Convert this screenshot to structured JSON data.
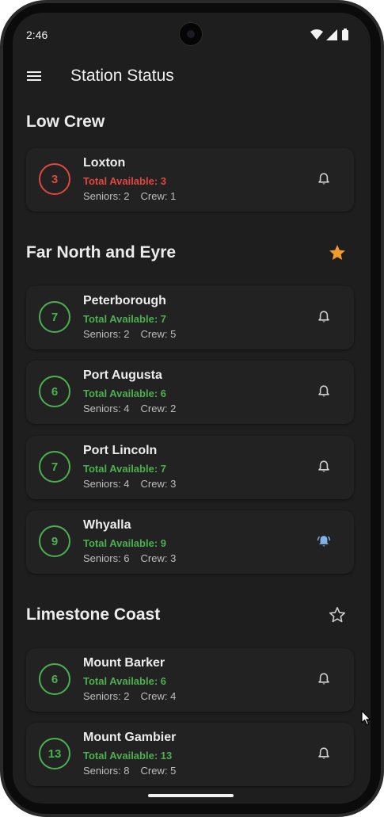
{
  "status_bar": {
    "time": "2:46"
  },
  "app_bar": {
    "title": "Station Status"
  },
  "colors": {
    "ok": "#4caf50",
    "low": "#e0473f",
    "favorite": "#f29a2e",
    "bell_active": "#7fb4e6"
  },
  "sections": [
    {
      "title": "Low Crew",
      "star": "none",
      "stations": [
        {
          "name": "Loxton",
          "count": "3",
          "total": "Total Available: 3",
          "seniors": "Seniors: 2",
          "crew": "Crew: 1",
          "status": "low",
          "bell": "bell-outline-icon"
        }
      ]
    },
    {
      "title": "Far North and Eyre",
      "star": "filled",
      "stations": [
        {
          "name": "Peterborough",
          "count": "7",
          "total": "Total Available: 7",
          "seniors": "Seniors: 2",
          "crew": "Crew: 5",
          "status": "ok",
          "bell": "bell-outline-icon"
        },
        {
          "name": "Port Augusta",
          "count": "6",
          "total": "Total Available: 6",
          "seniors": "Seniors: 4",
          "crew": "Crew: 2",
          "status": "ok",
          "bell": "bell-outline-icon"
        },
        {
          "name": "Port Lincoln",
          "count": "7",
          "total": "Total Available: 7",
          "seniors": "Seniors: 4",
          "crew": "Crew: 3",
          "status": "ok",
          "bell": "bell-outline-icon"
        },
        {
          "name": "Whyalla",
          "count": "9",
          "total": "Total Available: 9",
          "seniors": "Seniors: 6",
          "crew": "Crew: 3",
          "status": "ok",
          "bell": "bell-ringing-icon"
        }
      ]
    },
    {
      "title": "Limestone Coast",
      "star": "outline",
      "stations": [
        {
          "name": "Mount Barker",
          "count": "6",
          "total": "Total Available: 6",
          "seniors": "Seniors: 2",
          "crew": "Crew: 4",
          "status": "ok",
          "bell": "bell-outline-icon"
        },
        {
          "name": "Mount Gambier",
          "count": "13",
          "total": "Total Available: 13",
          "seniors": "Seniors: 8",
          "crew": "Crew: 5",
          "status": "ok",
          "bell": "bell-outline-icon"
        }
      ]
    }
  ]
}
